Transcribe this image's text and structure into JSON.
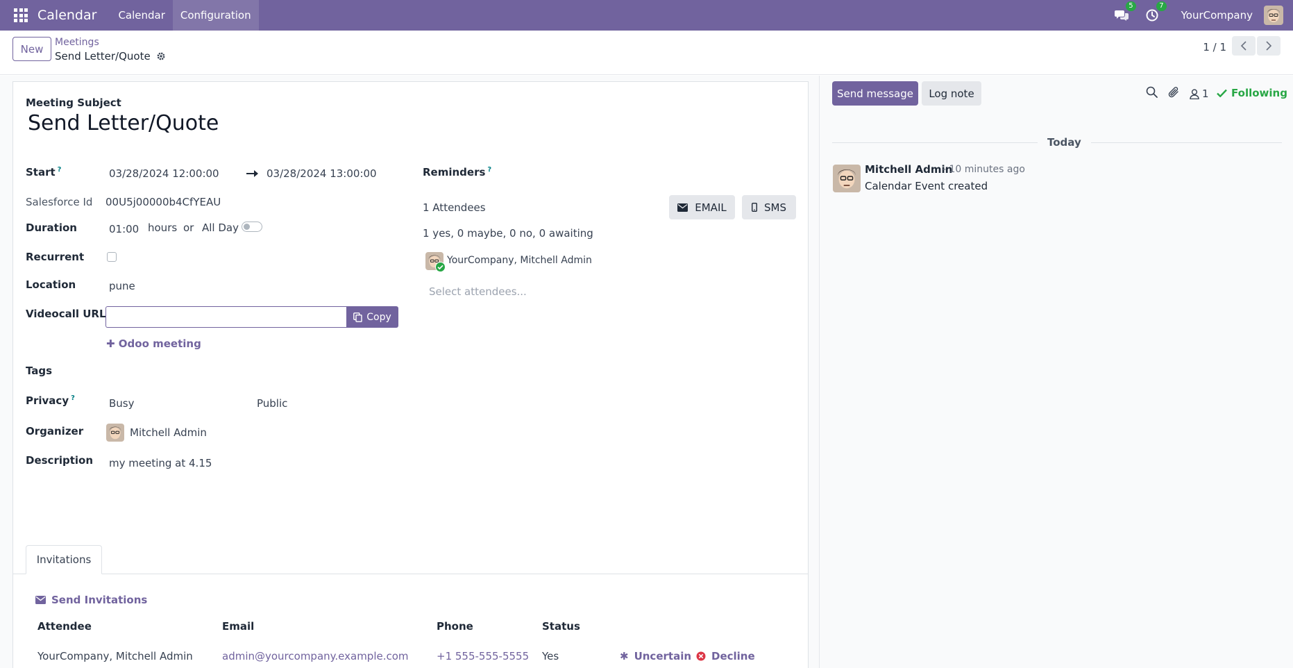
{
  "navbar": {
    "app_name": "Calendar",
    "menu": [
      "Calendar",
      "Configuration"
    ],
    "messages_badge": "5",
    "activities_badge": "7",
    "company": "YourCompany"
  },
  "control": {
    "new_label": "New",
    "breadcrumb_parent": "Meetings",
    "breadcrumb_current": "Send Letter/Quote",
    "pager": "1 / 1"
  },
  "form": {
    "subject_label": "Meeting Subject",
    "subject": "Send Letter/Quote",
    "start_label": "Start",
    "start_value": "03/28/2024 12:00:00",
    "end_value": "03/28/2024 13:00:00",
    "salesforce_label": "Salesforce Id",
    "salesforce_value": "00U5j00000b4CfYEAU",
    "duration_label": "Duration",
    "duration_value": "01:00",
    "hours_label": "hours",
    "or_label": "or",
    "allday_label": "All Day",
    "recurrent_label": "Recurrent",
    "location_label": "Location",
    "location_value": "pune",
    "videocall_label": "Videocall URL",
    "videocall_value": "",
    "copy_label": "Copy",
    "odoo_meeting_label": "Odoo meeting",
    "tags_label": "Tags",
    "privacy_label": "Privacy",
    "privacy_show_as": "Busy",
    "privacy_value": "Public",
    "organizer_label": "Organizer",
    "organizer_value": "Mitchell Admin",
    "description_label": "Description",
    "description_value": "my meeting at 4.15",
    "reminders_label": "Reminders",
    "attendees_count": "1 Attendees",
    "email_btn": "EMAIL",
    "sms_btn": "SMS",
    "attendee_summary": "1 yes, 0 maybe, 0 no, 0 awaiting",
    "attendee_name": "YourCompany, Mitchell Admin",
    "attendees_placeholder": "Select attendees..."
  },
  "tabs": {
    "invitations": "Invitations"
  },
  "invitations": {
    "send_label": "Send Invitations",
    "columns": [
      "Attendee",
      "Email",
      "Phone",
      "Status"
    ],
    "rows": [
      {
        "attendee": "YourCompany, Mitchell Admin",
        "email": "admin@yourcompany.example.com",
        "phone": "+1 555-555-5555",
        "status": "Yes",
        "uncertain": "Uncertain",
        "decline": "Decline"
      }
    ]
  },
  "chatter": {
    "send_message": "Send message",
    "log_note": "Log note",
    "followers_count": "1",
    "following": "Following",
    "date_separator": "Today",
    "messages": [
      {
        "author": "Mitchell Admin",
        "time": "- 10 minutes ago",
        "body": "Calendar Event created"
      }
    ]
  },
  "colors": {
    "brand": "#71639e",
    "success": "#28a745",
    "link_teal": "#017e84"
  }
}
